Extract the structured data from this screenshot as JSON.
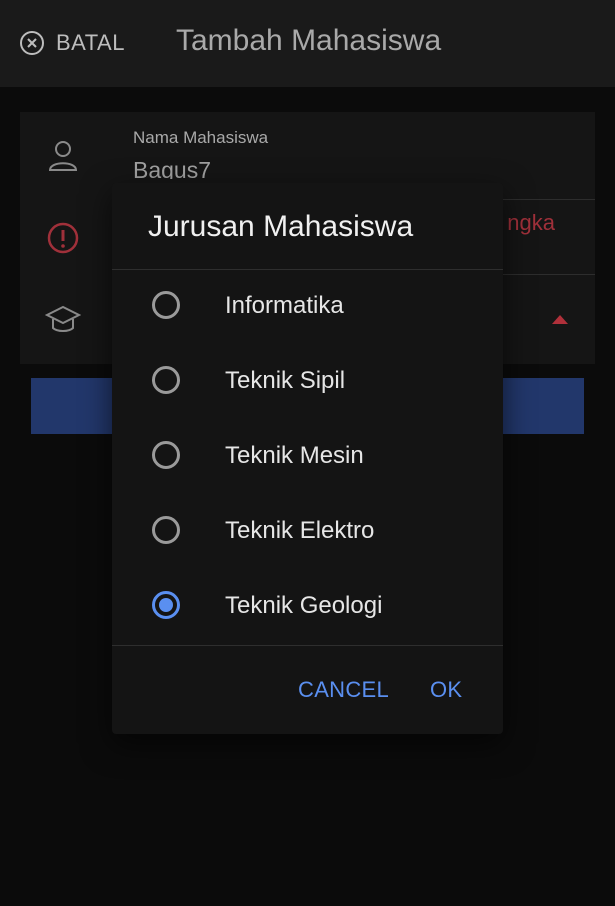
{
  "header": {
    "cancel_label": "BATAL",
    "cancel_icon": "close-circle-icon",
    "title": "Tambah Mahasiswa"
  },
  "form": {
    "name_label": "Nama Mahasiswa",
    "name_value": "Bagus7",
    "name_icon": "person-icon",
    "error_icon": "error-icon",
    "error_text_visible": "ngka",
    "major_icon": "graduation-cap-icon"
  },
  "dialog": {
    "title": "Jurusan Mahasiswa",
    "options": [
      {
        "label": "Informatika",
        "checked": false
      },
      {
        "label": "Teknik Sipil",
        "checked": false
      },
      {
        "label": "Teknik Mesin",
        "checked": false
      },
      {
        "label": "Teknik Elektro",
        "checked": false
      },
      {
        "label": "Teknik Geologi",
        "checked": true
      }
    ],
    "cancel_label": "CANCEL",
    "ok_label": "OK"
  },
  "colors": {
    "accent": "#5a8ff0",
    "error": "#a0303a",
    "submit_button": "#22376b"
  }
}
